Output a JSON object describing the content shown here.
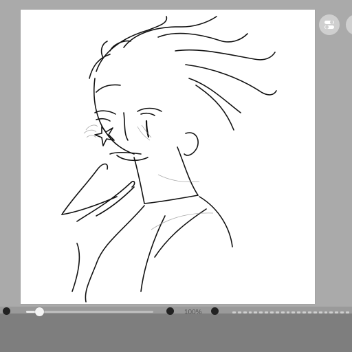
{
  "canvas": {
    "background": "#ffffff",
    "artwork_icon": "sketch-illustration"
  },
  "floating_controls": {
    "settings_icon": "toggle-settings-icon",
    "more_icon": "more-options-icon"
  },
  "bottom_toolbar": {
    "brush_size_progress": 0.1,
    "zoom_label": "100%",
    "page_indicator_count": 22
  },
  "colors": {
    "workspace": "#aaaaaa",
    "toolbar": "#7e7e7e",
    "button": "#cfcfcf"
  }
}
